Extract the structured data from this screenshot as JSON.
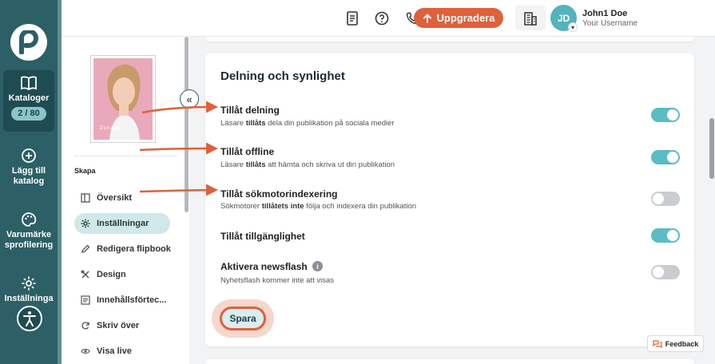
{
  "rail": {
    "items": [
      {
        "label": "Kataloger",
        "count": "2 / 80"
      },
      {
        "label": "Lägg till katalog"
      },
      {
        "label": "Varumärke sprofilering"
      },
      {
        "label": "Inställninga"
      }
    ]
  },
  "header": {
    "upgrade_label": "Uppgradera",
    "user_initials": "JD",
    "user_name": "John1 Doe",
    "user_sub": "Your Username"
  },
  "sidebar": {
    "thumb_caption": "Zenaida",
    "section_label": "Skapa",
    "items": [
      {
        "label": "Översikt"
      },
      {
        "label": "Inställningar"
      },
      {
        "label": "Redigera flipbook"
      },
      {
        "label": "Design"
      },
      {
        "label": "Innehållsförtec..."
      },
      {
        "label": "Skriv över"
      },
      {
        "label": "Visa live"
      }
    ]
  },
  "main": {
    "title": "Delning och synlighet",
    "options": [
      {
        "label": "Tillåt delning",
        "desc_pre": "Läsare ",
        "desc_bold": "tillåts",
        "desc_post": " dela din publikation på sociala medier",
        "on": true
      },
      {
        "label": "Tillåt offline",
        "desc_pre": "Läsare ",
        "desc_bold": "tillåts",
        "desc_post": " att hämta och skriva ut din publikation",
        "on": true
      },
      {
        "label": "Tillåt sökmotorindexering",
        "desc_pre": "Sökmotorer ",
        "desc_bold": "tillåtets inte",
        "desc_post": " följa och indexera din publikation",
        "on": false
      },
      {
        "label": "Tillåt tillgänglighet",
        "on": true
      },
      {
        "label": "Aktivera newsflash",
        "desc_pre": "Nyhetsflash kommer inte att visas",
        "on": false
      }
    ],
    "save_label": "Spara"
  },
  "feedback_label": "Feedback",
  "colors": {
    "rail": "#2c5f66",
    "accent": "#e0603a",
    "toggle_on": "#5bbcc4",
    "toggle_off": "#c9cdd1"
  }
}
